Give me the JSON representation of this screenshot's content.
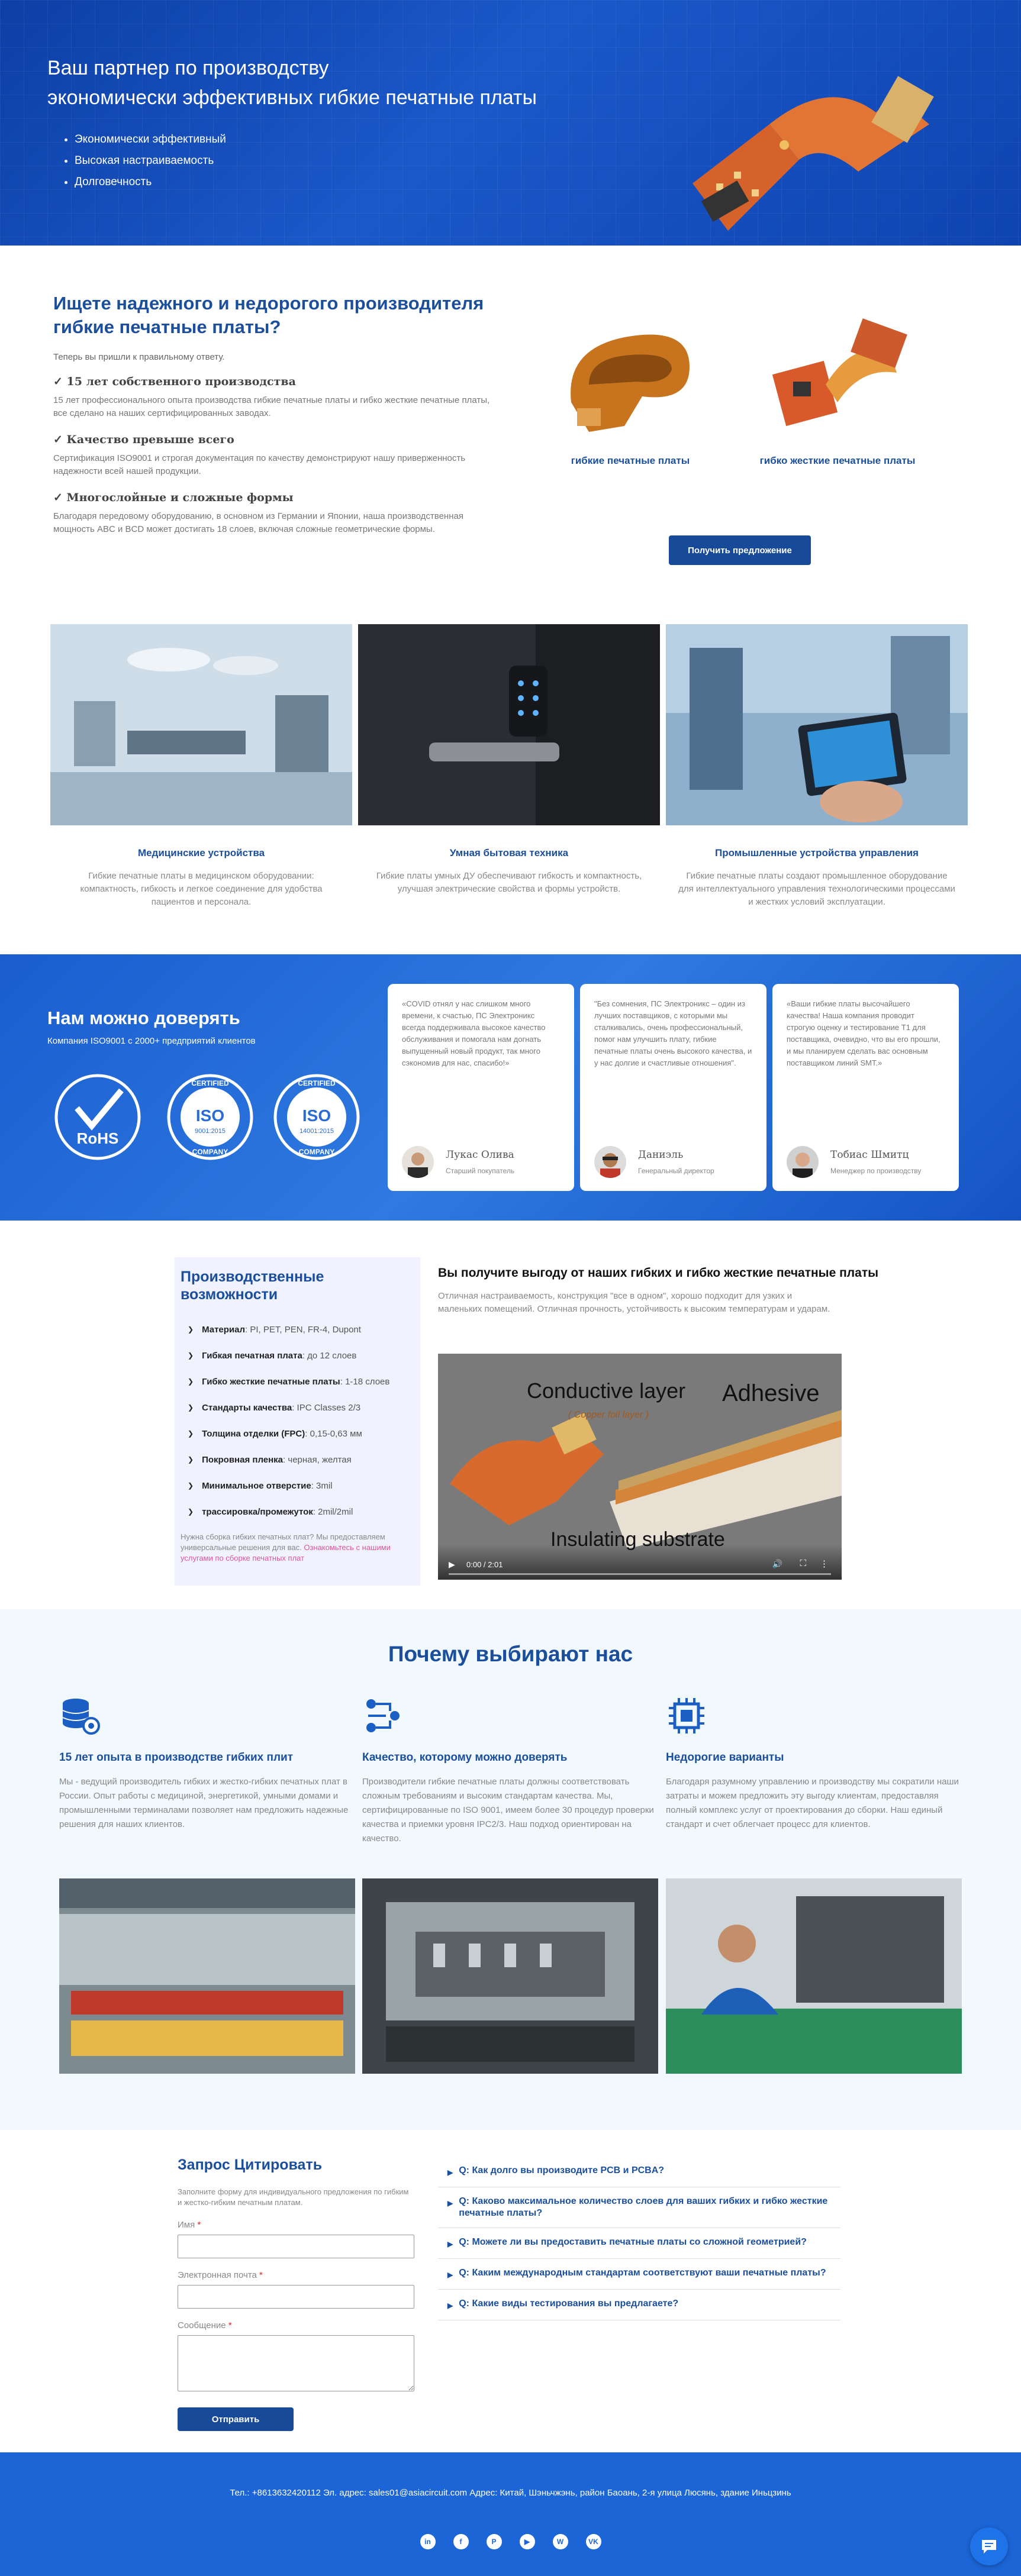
{
  "hero": {
    "title_line1": "Ваш партнер по производству",
    "title_line2": "экономически эффективных гибкие печатные платы",
    "bullets": [
      "Экономически эффективный",
      "Высокая настраиваемость",
      "Долговечность"
    ]
  },
  "intro": {
    "title": "Ищете надежного и недорогого производителя гибкие печатные платы?",
    "subtitle": "Теперь вы пришли к правильному ответу.",
    "features": [
      {
        "heading": "✓ 15 лет собственного производства",
        "text": "15 лет профессионального опыта производства гибкие печатные платы и гибко жесткие печатные платы, все сделано на наших сертифицированных заводах."
      },
      {
        "heading": "✓ Качество превыше всего",
        "text": "Сертификация ISO9001 и строгая документация по качеству демонстрируют нашу приверженность надежности всей нашей продукции."
      },
      {
        "heading": "✓ Многослойные и сложные формы",
        "text": "Благодаря передовому оборудованию, в основном из Германии и Японии, наша производственная мощность ABC и BCD может достигать 18 слоев, включая сложные геометрические формы."
      }
    ],
    "products": [
      "гибкие печатные платы",
      "гибко жесткие печатные платы"
    ],
    "quote_button": "Получить предложение"
  },
  "applications": [
    {
      "title": "Медицинские устройства",
      "desc": "Гибкие печатные платы в медицинском оборудовании: компактность, гибкость и легкое соединение для удобства пациентов и персонала."
    },
    {
      "title": "Умная бытовая техника",
      "desc": "Гибкие платы умных ДУ обеспечивают гибкость и компактность, улучшая электрические свойства и формы устройств."
    },
    {
      "title": "Промышленные устройства управления",
      "desc": "Гибкие печатные платы создают промышленное оборудование для интеллектуального управления технологическими процессами и жестких условий эксплуатации."
    }
  ],
  "trust": {
    "title": "Нам можно доверять",
    "subtitle": "Компания ISO9001 с 2000+ предприятий клиентов",
    "badges": [
      {
        "main": "RoHS"
      },
      {
        "top": "CERTIFIED",
        "main": "ISO",
        "code": "9001:2015",
        "bottom": "COMPANY"
      },
      {
        "top": "CERTIFIED",
        "main": "ISO",
        "code": "14001:2015",
        "bottom": "COMPANY"
      }
    ],
    "testimonials": [
      {
        "quote": "«COVID отнял у нас слишком много времени, к счастью, ПС Электроникс всегда поддерживала высокое качество обслуживания и помогала нам догнать выпущенный новый продукт, так много сэкономив для нас, спасибо!»",
        "name": "Лукас Олива",
        "role": "Старший покупатель"
      },
      {
        "quote": "\"Без сомнения, ПС Электроникс – один из лучших поставщиков, с которыми мы сталкивались, очень профессиональный, помог нам улучшить плату, гибкие печатные платы очень высокого качества, и у нас долгие и счастливые отношения\".",
        "name": "Даниэль",
        "role": "Генеральный директор"
      },
      {
        "quote": "«Ваши гибкие платы высочайшего качества! Наша компания проводит строгую оценку и тестирование T1 для поставщика, очевидно, что вы его прошли, и мы планируем сделать вас основным поставщиком линий SMT.»",
        "name": "Тобиас Шмитц",
        "role": "Менеджер по производству"
      }
    ]
  },
  "capabilities": {
    "title": "Производственные возможности",
    "items": [
      {
        "label": "Материал",
        "value": "PI, PET, PEN, FR-4, Dupont"
      },
      {
        "label": "Гибкая печатная плата",
        "value": "до 12 слоев"
      },
      {
        "label": "Гибко жесткие печатные платы",
        "value": "1-18 слоев"
      },
      {
        "label": "Стандарты качества",
        "value": "IPC Classes 2/3"
      },
      {
        "label": "Толщина отделки (FPC)",
        "value": "0,15-0,63 мм"
      },
      {
        "label": "Покровная пленка",
        "value": "черная, желтая"
      },
      {
        "label": "Минимальное отверстие",
        "value": "3mil"
      },
      {
        "label": "трассировка/промежуток",
        "value": "2mil/2mil"
      }
    ],
    "note": "Нужна сборка гибких печатных плат? Мы предоставляем универсальные решения для вас.",
    "note_link": "Ознакомьтесь с нашими услугами по сборке печатных плат"
  },
  "benefit": {
    "title": "Вы получите выгоду от наших гибких и гибко жесткие печатные платы",
    "desc": "Отличная настраиваемость, конструкция \"все в одном\", хорошо подходит для узких и маленьких помещений. Отличная прочность, устойчивость к высоким температурам и ударам.",
    "video": {
      "label1": "Conductive layer",
      "label1_sub": "( Copper foil layer )",
      "label2": "Adhesive",
      "label3": "Insulating substrate",
      "time": "0:00 / 2:01"
    }
  },
  "why": {
    "title": "Почему выбирают нас",
    "cols": [
      {
        "title": "15 лет опыта в производстве гибких плит",
        "text": "Мы - ведущий производитель гибких и жестко-гибких печатных плат в России. Опыт работы с медициной, энергетикой, умными домами и промышленными терминалами позволяет нам предложить надежные решения для наших клиентов."
      },
      {
        "title": "Качество, которому можно доверять",
        "text": "Производители гибкие печатные платы должны соответствовать сложным требованиям и высоким стандартам качества. Мы, сертифицированные по ISO 9001, имеем более 30 процедур проверки качества и приемки уровня IPC2/3. Наш подход ориентирован на качество."
      },
      {
        "title": "Недорогие варианты",
        "text": "Благодаря разумному управлению и производству мы сократили наши затраты и можем предложить эту выгоду клиентам, предоставляя полный комплекс услуг от проектирования до сборки. Наш единый стандарт и счет облегчает процесс для клиентов."
      }
    ]
  },
  "form": {
    "title": "Запрос Цитировать",
    "subtitle": "Заполните форму для индивидуального предложения по гибким и жестко-гибким печатным платам.",
    "name_label": "Имя",
    "email_label": "Электронная почта",
    "message_label": "Сообщение",
    "required_mark": "*",
    "submit": "Отправить"
  },
  "faq": [
    "Q: Как долго вы производите PCB и PCBA?",
    "Q: Каково максимальное количество слоев для ваших гибких и гибко жесткие печатные платы?",
    "Q: Можете ли вы предоставить печатные платы со сложной геометрией?",
    "Q: Каким международным стандартам соответствуют ваши печатные платы?",
    "Q: Какие виды тестирования вы предлагаете?"
  ],
  "footer": {
    "contact": "Тел.: +8613632420112    Эл. адрес: sales01@asiacircuit.com    Адрес: Китай, Шэньчжэнь, район Баоань, 2-я улица Люсянь, здание Иньцзинь",
    "socials": [
      "in",
      "f",
      "P",
      "▶",
      "W",
      "VK"
    ]
  },
  "colors": {
    "brand_blue": "#1b4f9c",
    "hero_blue": "#1a58c8",
    "footer_blue": "#1c65d6",
    "accent_pink": "#e0559a"
  }
}
